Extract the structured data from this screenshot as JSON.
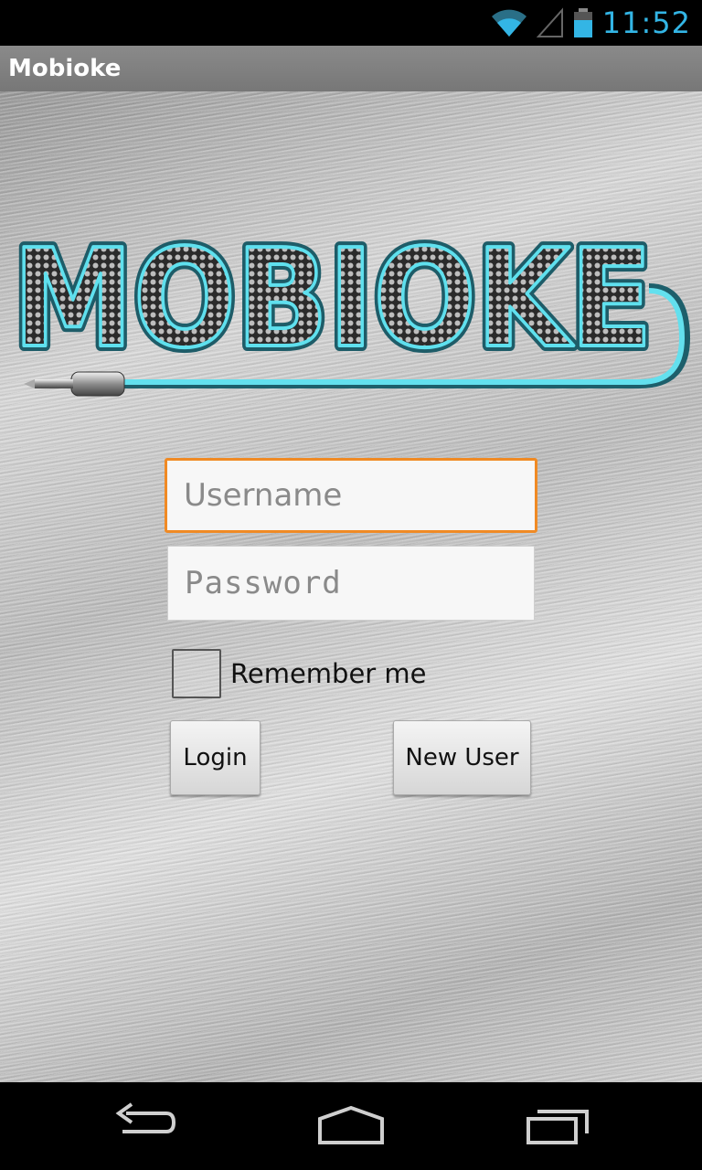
{
  "status_bar": {
    "time": "11:52",
    "icons": [
      "wifi-icon",
      "signal-icon",
      "battery-icon"
    ],
    "accent_color": "#33b5e5"
  },
  "action_bar": {
    "title": "Mobioke"
  },
  "logo": {
    "text": "MOBIOKE",
    "accent_color": "#4fd6e6"
  },
  "login_form": {
    "username": {
      "placeholder": "Username",
      "value": "",
      "focus_color": "#f08a24"
    },
    "password": {
      "placeholder": "Password",
      "value": ""
    },
    "remember_me": {
      "label": "Remember me",
      "checked": false
    },
    "login_label": "Login",
    "new_user_label": "New User"
  },
  "nav_bar": {
    "icons": [
      "back-icon",
      "home-icon",
      "recent-apps-icon"
    ]
  }
}
